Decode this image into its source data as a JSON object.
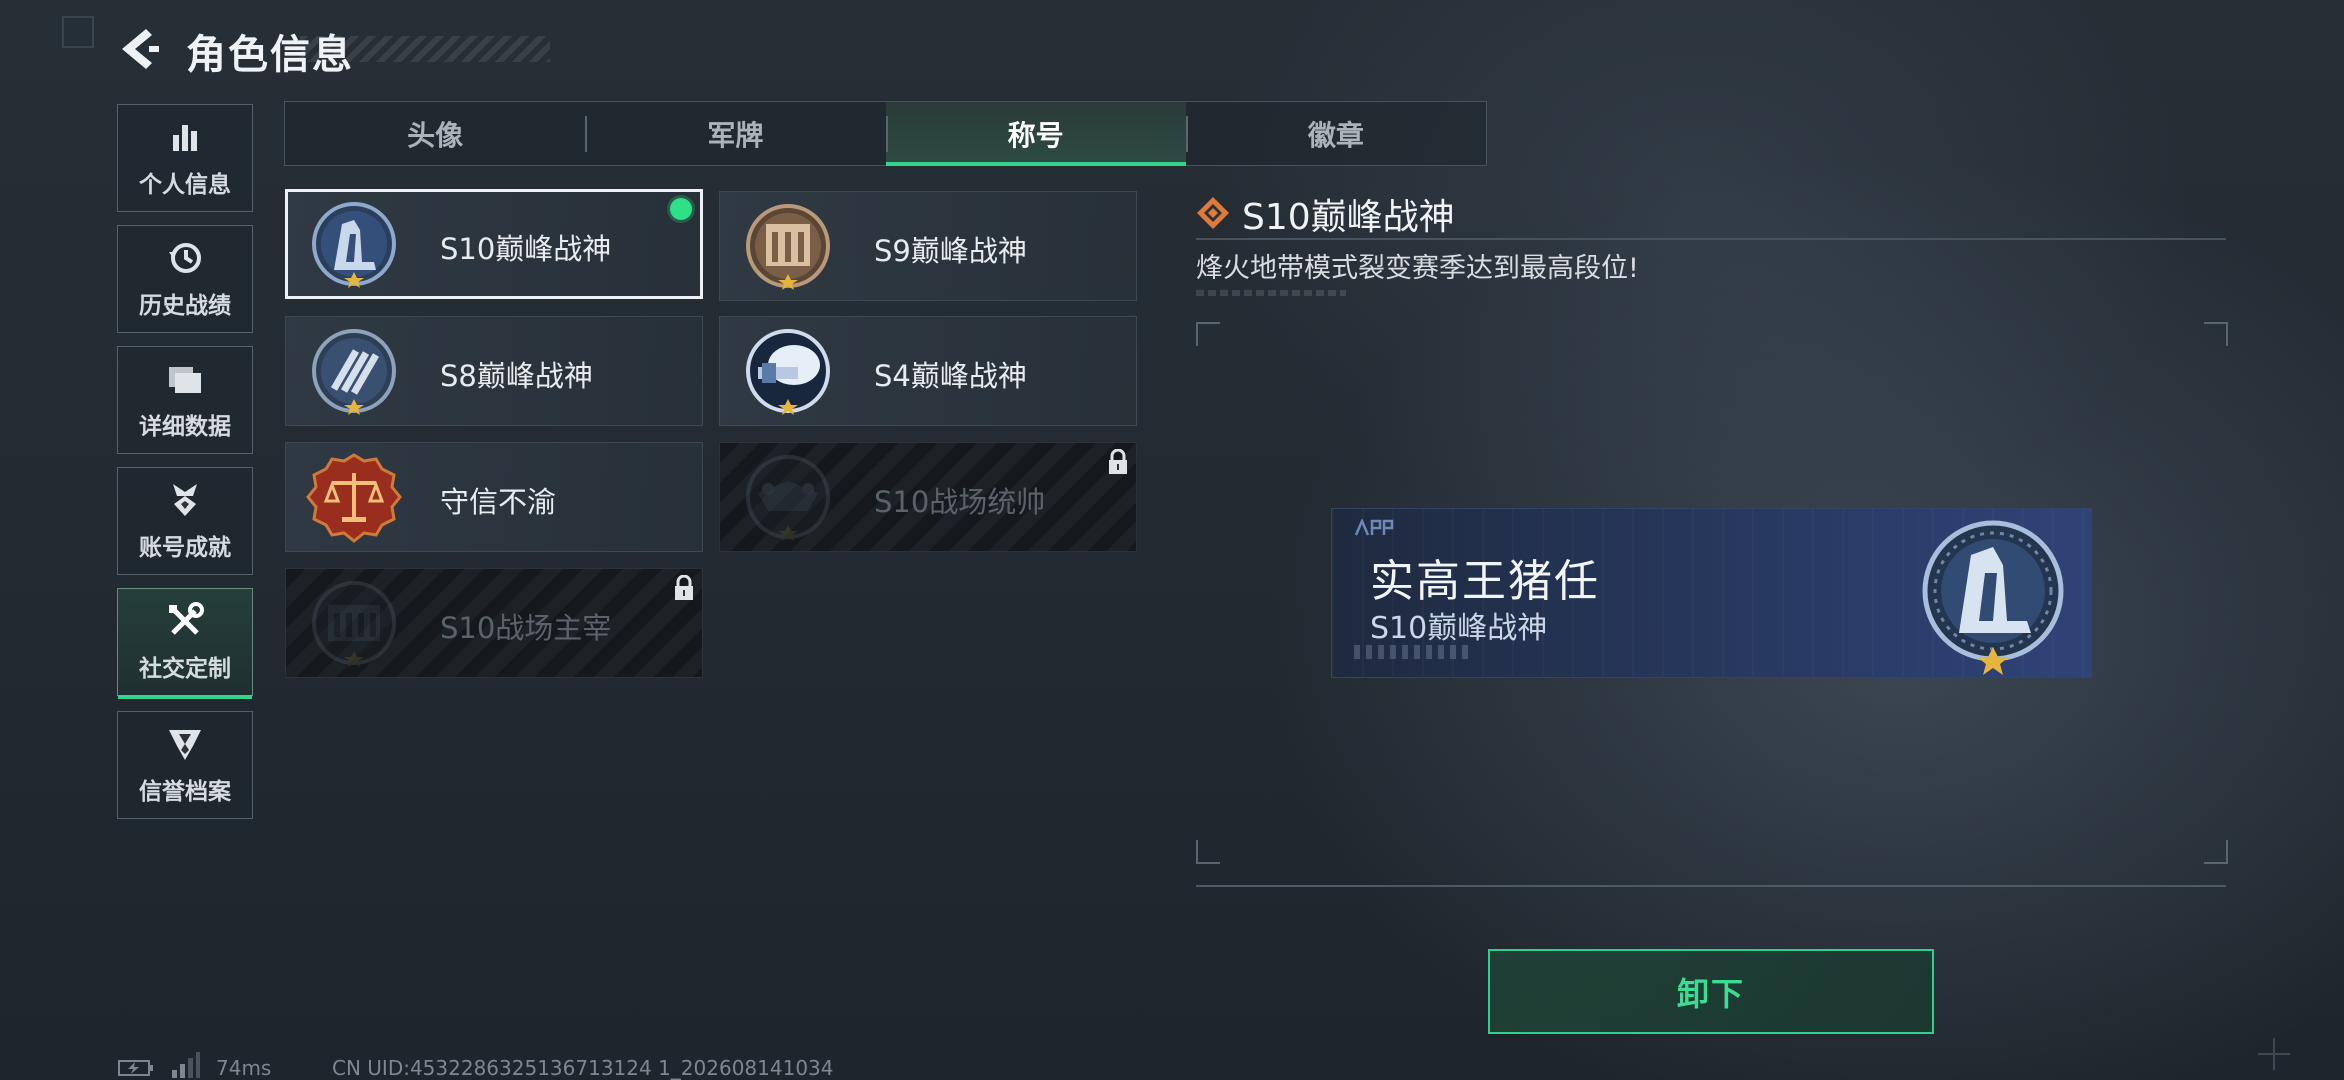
{
  "header": {
    "title": "角色信息"
  },
  "sidebar": {
    "items": [
      {
        "label": "个人信息",
        "icon": "bar-chart-icon"
      },
      {
        "label": "历史战绩",
        "icon": "history-clock-icon"
      },
      {
        "label": "详细数据",
        "icon": "folder-icon"
      },
      {
        "label": "账号成就",
        "icon": "achievement-medal-icon"
      },
      {
        "label": "社交定制",
        "icon": "tools-icon",
        "active": true
      },
      {
        "label": "信誉档案",
        "icon": "credit-shield-icon"
      }
    ]
  },
  "tabs": [
    {
      "label": "头像"
    },
    {
      "label": "军牌"
    },
    {
      "label": "称号",
      "active": true
    },
    {
      "label": "徽章"
    }
  ],
  "titles": [
    {
      "name": "S10巅峰战神",
      "selected": true,
      "equipped": true,
      "locked": false,
      "badge": "s10-peak-badge-icon"
    },
    {
      "name": "S9巅峰战神",
      "locked": false,
      "badge": "s9-peak-badge-icon"
    },
    {
      "name": "S8巅峰战神",
      "locked": false,
      "badge": "s8-peak-badge-icon"
    },
    {
      "name": "S4巅峰战神",
      "locked": false,
      "badge": "s4-peak-badge-icon"
    },
    {
      "name": "守信不渝",
      "locked": false,
      "badge": "scales-badge-icon"
    },
    {
      "name": "S10战场统帅",
      "locked": true,
      "badge": "s10-commander-badge-icon"
    },
    {
      "name": "S10战场主宰",
      "locked": true,
      "badge": "s10-dominator-badge-icon"
    }
  ],
  "detail": {
    "title": "S10巅峰战神",
    "description": "烽火地带模式裂变赛季达到最高段位!"
  },
  "nameplate": {
    "player_name": "实高王猪任",
    "title": "S10巅峰战神"
  },
  "actions": {
    "unequip_label": "卸下"
  },
  "footer": {
    "ping": "74ms",
    "uid": "CN UID:4532286325136713124 1_202608141034"
  },
  "colors": {
    "accent_green": "#36d38f",
    "equipped_dot": "#2ee089",
    "detail_diamond": "#e07a3a",
    "badge_blue": "#7fa0c8",
    "badge_gold": "#e7b53b"
  }
}
